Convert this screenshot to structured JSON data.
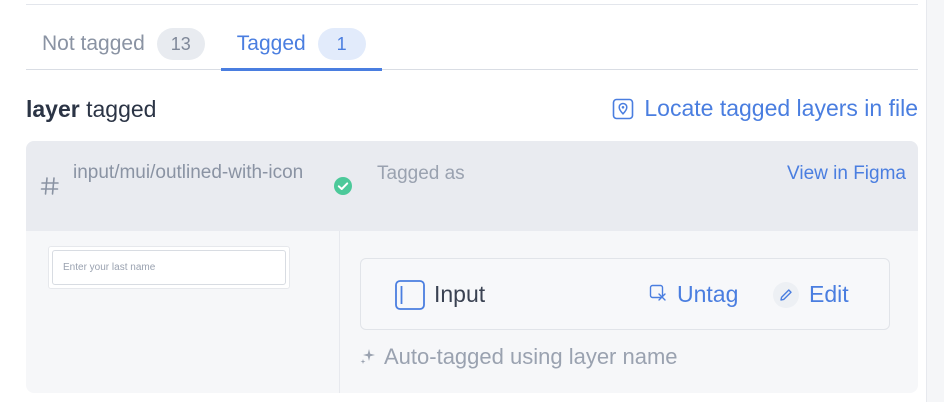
{
  "tabs": [
    {
      "label": "Not tagged",
      "count": "13",
      "active": false
    },
    {
      "label": "Tagged",
      "count": "1",
      "active": true
    }
  ],
  "section": {
    "title_strong": "layer",
    "title_rest": " tagged",
    "locate_label": "Locate tagged layers in file",
    "locate_icon": "location-pin-icon"
  },
  "card": {
    "layer_icon": "hash-icon",
    "layer_name": "input/mui/outlined-with-icon",
    "status_icon": "check-circle-icon",
    "tagged_as_label": "Tagged as",
    "view_in_figma_label": "View in Figma",
    "preview_placeholder": "Enter your last name",
    "component": {
      "icon": "input-component-icon",
      "name": "Input",
      "untag_label": "Untag",
      "untag_icon": "untag-icon",
      "edit_label": "Edit",
      "edit_icon": "pencil-icon"
    },
    "auto_note": "Auto-tagged using layer name",
    "auto_icon": "sparkle-icon"
  },
  "colors": {
    "accent": "#4a7ee0",
    "success": "#4cc99a",
    "muted_text": "#8a93a3",
    "header_bg": "#e9ebf0"
  }
}
